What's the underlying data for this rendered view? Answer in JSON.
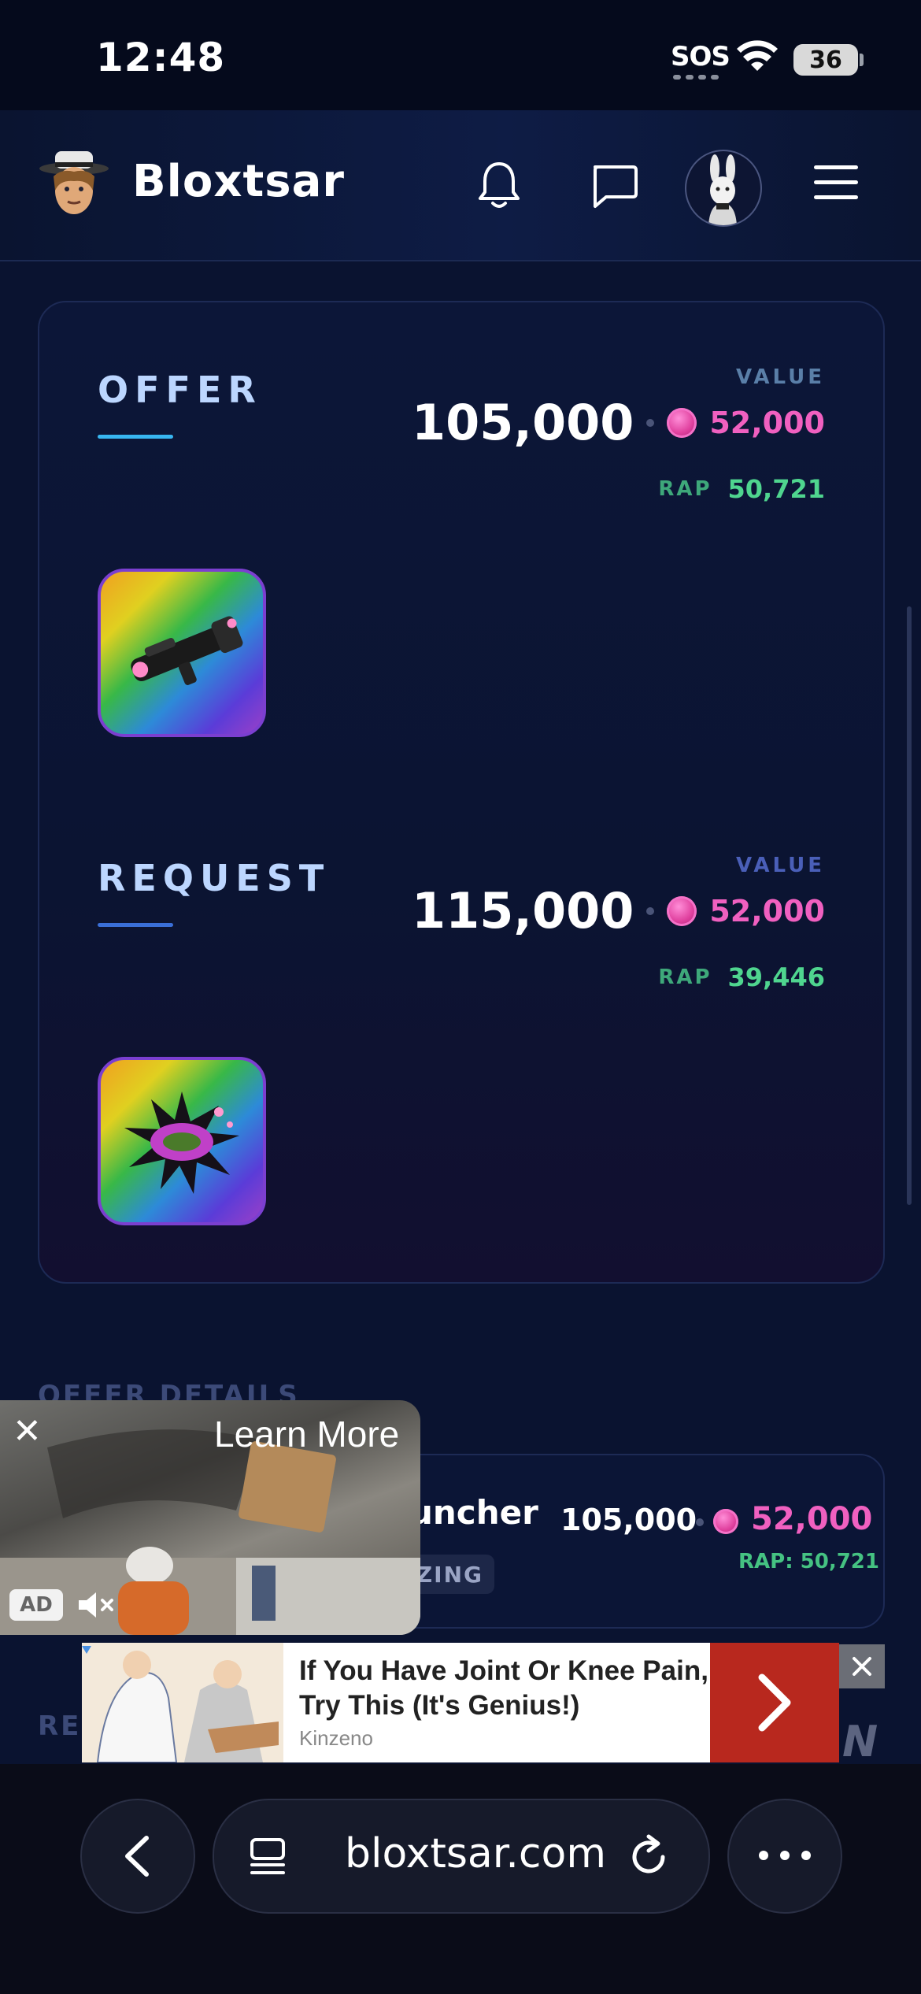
{
  "status_bar": {
    "time": "12:48",
    "sos": "SOS",
    "battery": "36"
  },
  "header": {
    "brand": "Bloxtsar",
    "icons": [
      "avatar-icon",
      "bell-icon",
      "chat-icon",
      "user-avatar-icon",
      "menu-icon"
    ]
  },
  "offer": {
    "title": "OFFER",
    "value_label": "VALUE",
    "value": "105,000",
    "gem_value": "52,000",
    "rap_label": "RAP",
    "rap_value": "50,721",
    "accent": "#38b6f0"
  },
  "request": {
    "title": "REQUEST",
    "value_label": "VALUE",
    "value": "115,000",
    "gem_value": "52,000",
    "rap_label": "RAP",
    "rap_value": "39,446",
    "accent": "#3a6fd8"
  },
  "offer_details": {
    "title": "OFFER DETAILS",
    "item_name_fragment": "uncher",
    "badge_fragment": "ZING",
    "value": "105,000",
    "gem_value": "52,000",
    "rap": "RAP: 50,721"
  },
  "video_ad": {
    "learn_more": "Learn More",
    "ad_label": "AD"
  },
  "behind_text": "RE",
  "banner_ad": {
    "headline": "If You Have Joint Or Knee Pain, Try This (It's Genius!)",
    "source": "Kinzeno"
  },
  "browser": {
    "url": "bloxtsar.com"
  },
  "colors": {
    "background": "#0a1330",
    "pink": "#f060c0",
    "green": "#4fd58f",
    "banner_red": "#b8281e"
  }
}
